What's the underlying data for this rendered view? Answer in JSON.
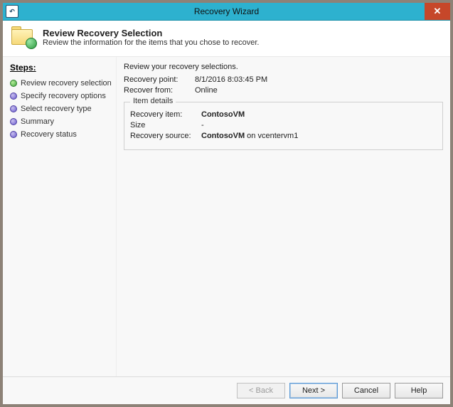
{
  "window": {
    "title": "Recovery Wizard",
    "sys_icon_label": "↶",
    "close_label": "✕"
  },
  "header": {
    "title": "Review Recovery Selection",
    "subtitle": "Review the information for the items that you chose to recover."
  },
  "sidebar": {
    "title": "Steps:",
    "items": [
      {
        "label": "Review recovery selection",
        "state": "current"
      },
      {
        "label": "Specify recovery options",
        "state": "pending"
      },
      {
        "label": "Select recovery type",
        "state": "pending"
      },
      {
        "label": "Summary",
        "state": "pending"
      },
      {
        "label": "Recovery status",
        "state": "pending"
      }
    ]
  },
  "content": {
    "intro": "Review your recovery selections.",
    "recovery_point": {
      "label": "Recovery point:",
      "value": "8/1/2016 8:03:45 PM"
    },
    "recover_from": {
      "label": "Recover from:",
      "value": "Online"
    },
    "item_details": {
      "legend": "Item details",
      "recovery_item": {
        "label": "Recovery item:",
        "value": "ContosoVM"
      },
      "size": {
        "label": "Size",
        "value": "-"
      },
      "recovery_source": {
        "label": "Recovery source:",
        "value_prefix": "ContosoVM",
        "value_suffix": " on vcentervm1"
      }
    }
  },
  "footer": {
    "back": "< Back",
    "next": "Next >",
    "cancel": "Cancel",
    "help": "Help"
  }
}
